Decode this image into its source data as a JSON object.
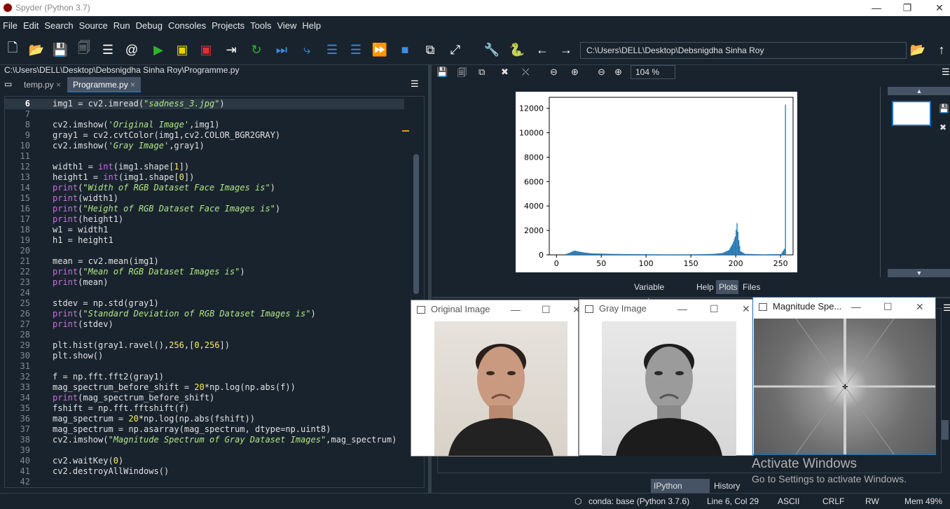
{
  "window": {
    "title": "Spyder (Python 3.7)",
    "minimize": "—",
    "restore": "❐",
    "close": "✕"
  },
  "menu": [
    "File",
    "Edit",
    "Search",
    "Source",
    "Run",
    "Debug",
    "Consoles",
    "Projects",
    "Tools",
    "View",
    "Help"
  ],
  "toolbar": {
    "path": "C:\\Users\\DELL\\Desktop\\Debsnigdha Sinha Roy"
  },
  "editor": {
    "file_path": "C:\\Users\\DELL\\Desktop\\Debsnigdha Sinha Roy\\Programme.py",
    "tabs": [
      {
        "label": "temp.py"
      },
      {
        "label": "Programme.py"
      }
    ],
    "lines": [
      {
        "n": "6",
        "t": "img1 = cv2.imread(\"sadness_3.jpg\")"
      },
      {
        "n": "7",
        "t": ""
      },
      {
        "n": "8",
        "t": "cv2.imshow('Original Image',img1)"
      },
      {
        "n": "9",
        "t": "gray1 = cv2.cvtColor(img1,cv2.COLOR_BGR2GRAY)"
      },
      {
        "n": "10",
        "t": "cv2.imshow('Gray Image',gray1)"
      },
      {
        "n": "11",
        "t": ""
      },
      {
        "n": "12",
        "t": "width1 = int(img1.shape[1])"
      },
      {
        "n": "13",
        "t": "height1 = int(img1.shape[0])"
      },
      {
        "n": "14",
        "t": "print(\"Width of RGB Dataset Face Images is\")"
      },
      {
        "n": "15",
        "t": "print(width1)"
      },
      {
        "n": "16",
        "t": "print(\"Height of RGB Dataset Face Images is\")"
      },
      {
        "n": "17",
        "t": "print(height1)"
      },
      {
        "n": "18",
        "t": "w1 = width1"
      },
      {
        "n": "19",
        "t": "h1 = height1"
      },
      {
        "n": "20",
        "t": ""
      },
      {
        "n": "21",
        "t": "mean = cv2.mean(img1)"
      },
      {
        "n": "22",
        "t": "print(\"Mean of RGB Dataset Images is\")"
      },
      {
        "n": "23",
        "t": "print(mean)"
      },
      {
        "n": "24",
        "t": ""
      },
      {
        "n": "25",
        "t": "stdev = np.std(gray1)"
      },
      {
        "n": "26",
        "t": "print(\"Standard Deviation of RGB Dataset Images is\")"
      },
      {
        "n": "27",
        "t": "print(stdev)"
      },
      {
        "n": "28",
        "t": ""
      },
      {
        "n": "29",
        "t": "plt.hist(gray1.ravel(),256,[0,256])"
      },
      {
        "n": "30",
        "t": "plt.show()"
      },
      {
        "n": "31",
        "t": ""
      },
      {
        "n": "32",
        "t": "f = np.fft.fft2(gray1)"
      },
      {
        "n": "33",
        "t": "mag_spectrum_before_shift = 20*np.log(np.abs(f))"
      },
      {
        "n": "34",
        "t": "print(mag_spectrum_before_shift)"
      },
      {
        "n": "35",
        "t": "fshift = np.fft.fftshift(f)"
      },
      {
        "n": "36",
        "t": "mag_spectrum = 20*np.log(np.abs(fshift))"
      },
      {
        "n": "37",
        "t": "mag_spectrum = np.asarray(mag_spectrum, dtype=np.uint8)"
      },
      {
        "n": "38",
        "t": "cv2.imshow(\"Magnitude Spectrum of Gray Dataset Images\",mag_spectrum)"
      },
      {
        "n": "39",
        "t": ""
      },
      {
        "n": "40",
        "t": "cv2.waitKey(0)"
      },
      {
        "n": "41",
        "t": "cv2.destroyAllWindows()"
      },
      {
        "n": "42",
        "t": ""
      }
    ]
  },
  "plots": {
    "zoom": "104 %",
    "pane_tabs": [
      "Variable explorer",
      "Help",
      "Plots",
      "Files"
    ],
    "histogram": {
      "type": "bar",
      "yticks": [
        "0",
        "2000",
        "4000",
        "6000",
        "8000",
        "10000",
        "12000"
      ],
      "xticks": [
        "0",
        "50",
        "100",
        "150",
        "200",
        "250"
      ],
      "xlim": [
        -8,
        264
      ],
      "ylim": [
        0,
        12900
      ],
      "bins": [
        [
          10,
          60
        ],
        [
          15,
          200
        ],
        [
          18,
          300
        ],
        [
          20,
          350
        ],
        [
          22,
          320
        ],
        [
          25,
          260
        ],
        [
          30,
          200
        ],
        [
          35,
          150
        ],
        [
          40,
          120
        ],
        [
          50,
          100
        ],
        [
          60,
          80
        ],
        [
          80,
          60
        ],
        [
          100,
          50
        ],
        [
          120,
          40
        ],
        [
          140,
          40
        ],
        [
          160,
          50
        ],
        [
          175,
          80
        ],
        [
          185,
          150
        ],
        [
          192,
          400
        ],
        [
          196,
          900
        ],
        [
          199,
          1500
        ],
        [
          201,
          2600
        ],
        [
          203,
          1200
        ],
        [
          205,
          300
        ],
        [
          210,
          80
        ],
        [
          230,
          40
        ],
        [
          250,
          60
        ],
        [
          254,
          500
        ],
        [
          255,
          12300
        ]
      ],
      "color": "#1f77b4"
    }
  },
  "windows": {
    "original": {
      "title": "Original Image"
    },
    "gray": {
      "title": "Gray Image"
    },
    "magnitude": {
      "title": "Magnitude Spe..."
    }
  },
  "console_tabs": [
    "IPython console",
    "History"
  ],
  "watermark": {
    "line1": "Activate Windows",
    "line2": "Go to Settings to activate Windows."
  },
  "status": {
    "env": "conda: base (Python 3.7.6)",
    "pos": "Line 6, Col 29",
    "enc": "ASCII",
    "eol": "CRLF",
    "rw": "RW",
    "mem": "Mem 49%"
  }
}
